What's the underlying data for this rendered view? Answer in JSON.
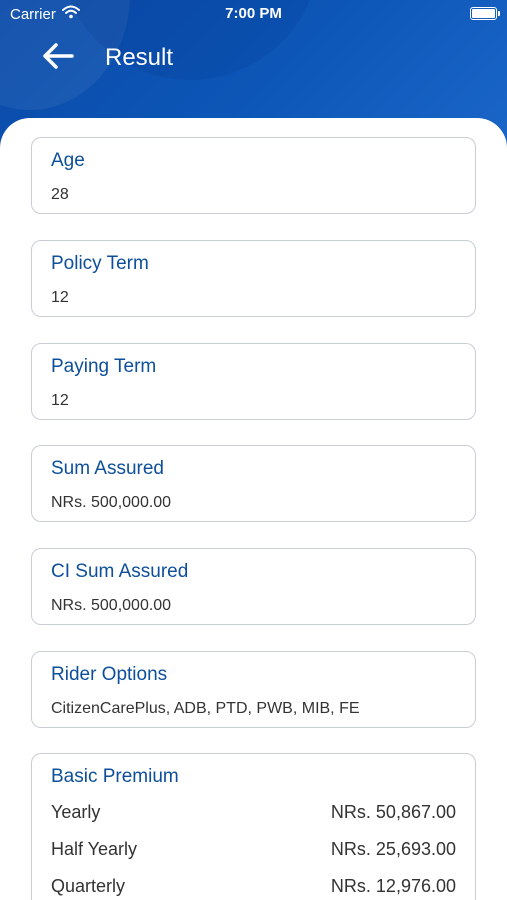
{
  "status_bar": {
    "carrier": "Carrier",
    "time": "7:00 PM"
  },
  "nav": {
    "title": "Result"
  },
  "fields": [
    {
      "title": "Age",
      "value": "28"
    },
    {
      "title": "Policy Term",
      "value": "12"
    },
    {
      "title": "Paying Term",
      "value": "12"
    },
    {
      "title": "Sum Assured",
      "value": "NRs. 500,000.00"
    },
    {
      "title": "CI Sum Assured",
      "value": "NRs. 500,000.00"
    },
    {
      "title": "Rider Options",
      "value": "CitizenCarePlus, ADB, PTD, PWB, MIB, FE"
    }
  ],
  "basic_premium": {
    "title": "Basic Premium",
    "rows": [
      {
        "label": "Yearly",
        "value": "NRs. 50,867.00"
      },
      {
        "label": "Half Yearly",
        "value": "NRs. 25,693.00"
      },
      {
        "label": "Quarterly",
        "value": "NRs. 12,976.00"
      }
    ]
  },
  "colors": {
    "header": "#0d57b8",
    "title_text": "#0d4f9a",
    "card_border": "#c9ced6"
  }
}
